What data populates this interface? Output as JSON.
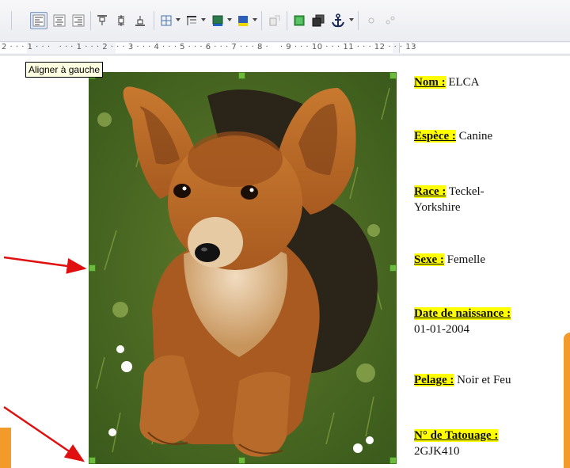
{
  "toolbar": {
    "buttons": [
      {
        "name": "align-left-icon",
        "active": true
      },
      {
        "name": "align-center-icon",
        "active": false
      },
      {
        "name": "align-right-icon",
        "active": false
      },
      {
        "name": "align-top-icon",
        "active": false
      },
      {
        "name": "align-middle-icon",
        "active": false
      },
      {
        "name": "align-bottom-icon",
        "active": false
      },
      {
        "name": "borders-icon",
        "active": false
      },
      {
        "name": "line-style-icon",
        "active": false
      },
      {
        "name": "border-color-icon",
        "active": false
      },
      {
        "name": "background-color-icon",
        "active": false
      },
      {
        "name": "linked-frame-icon",
        "active": false
      },
      {
        "name": "bring-to-front-icon",
        "active": false
      },
      {
        "name": "send-to-back-icon",
        "active": false
      },
      {
        "name": "anchor-icon",
        "active": false
      },
      {
        "name": "link-frames-icon",
        "active": false
      },
      {
        "name": "unlink-frames-icon",
        "active": false
      }
    ]
  },
  "ruler": {
    "text": "2 · · · 1 · · ·   · · · 1 · · · 2 · · · 3 · · · 4 · · · 5 · · · 6 · · · 7 · · · 8 ·    · 9 · · · 10 · · · 11 · · · 12 · · · 13"
  },
  "tooltip": {
    "text": "Aligner à gauche"
  },
  "info": {
    "fields": [
      {
        "label": "Nom :",
        "value": " ELCA"
      },
      {
        "label": "Espèce :",
        "value": " Canine"
      },
      {
        "label": "Race :",
        "value": " Teckel-Yorkshire"
      },
      {
        "label": "Sexe :",
        "value": " Femelle"
      },
      {
        "label": "Date de naissance :",
        "value": "01-01-2004"
      },
      {
        "label": "Pelage :",
        "value": " Noir et Feu"
      },
      {
        "label": "N° de Tatouage :",
        "value": "2GJK410"
      }
    ]
  },
  "colors": {
    "highlight": "#ffff00",
    "arrow": "#e01010",
    "handle": "#6dbb3c",
    "accent_orange": "#f29a2a"
  }
}
